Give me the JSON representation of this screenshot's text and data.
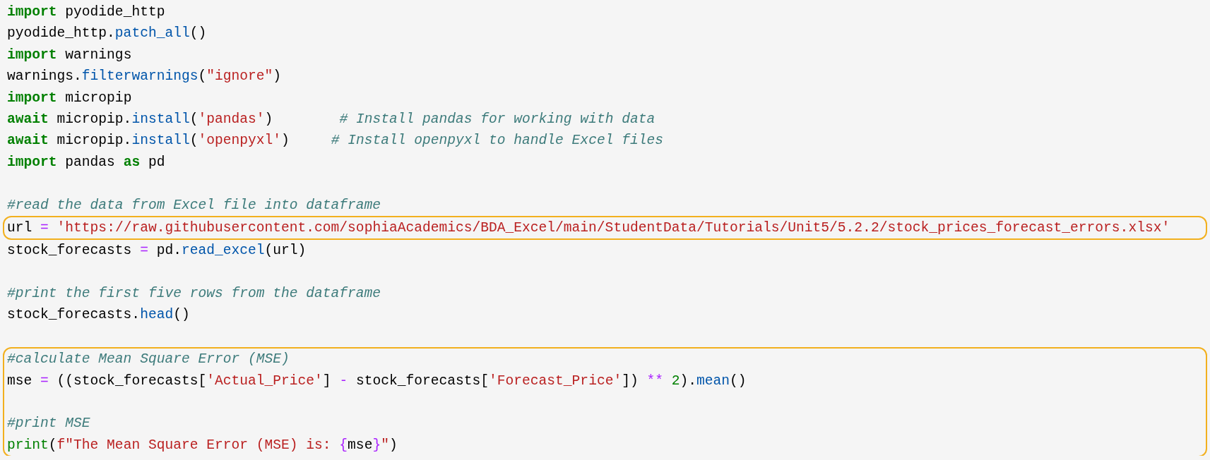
{
  "groups": [
    {
      "highlighted": false,
      "lines": [
        {
          "kind": "code",
          "tokens": [
            {
              "kind": "kw",
              "text": "import"
            },
            {
              "kind": "plain",
              "text": " pyodide_http"
            }
          ]
        },
        {
          "kind": "code",
          "tokens": [
            {
              "kind": "plain",
              "text": "pyodide_http."
            },
            {
              "kind": "fn",
              "text": "patch_all"
            },
            {
              "kind": "plain",
              "text": "()"
            }
          ]
        },
        {
          "kind": "code",
          "tokens": [
            {
              "kind": "kw",
              "text": "import"
            },
            {
              "kind": "plain",
              "text": " warnings"
            }
          ]
        },
        {
          "kind": "code",
          "tokens": [
            {
              "kind": "plain",
              "text": "warnings."
            },
            {
              "kind": "fn",
              "text": "filterwarnings"
            },
            {
              "kind": "plain",
              "text": "("
            },
            {
              "kind": "str",
              "text": "\"ignore\""
            },
            {
              "kind": "plain",
              "text": ")"
            }
          ]
        },
        {
          "kind": "code",
          "tokens": [
            {
              "kind": "kw",
              "text": "import"
            },
            {
              "kind": "plain",
              "text": " micropip"
            }
          ]
        },
        {
          "kind": "code",
          "tokens": [
            {
              "kind": "kw",
              "text": "await"
            },
            {
              "kind": "plain",
              "text": " micropip."
            },
            {
              "kind": "fn",
              "text": "install"
            },
            {
              "kind": "plain",
              "text": "("
            },
            {
              "kind": "str",
              "text": "'pandas'"
            },
            {
              "kind": "plain",
              "text": ")        "
            },
            {
              "kind": "cmt",
              "text": "# Install pandas for working with data"
            }
          ]
        },
        {
          "kind": "code",
          "tokens": [
            {
              "kind": "kw",
              "text": "await"
            },
            {
              "kind": "plain",
              "text": " micropip."
            },
            {
              "kind": "fn",
              "text": "install"
            },
            {
              "kind": "plain",
              "text": "("
            },
            {
              "kind": "str",
              "text": "'openpyxl'"
            },
            {
              "kind": "plain",
              "text": ")     "
            },
            {
              "kind": "cmt",
              "text": "# Install openpyxl to handle Excel files"
            }
          ]
        },
        {
          "kind": "code",
          "tokens": [
            {
              "kind": "kw",
              "text": "import"
            },
            {
              "kind": "plain",
              "text": " pandas "
            },
            {
              "kind": "kw",
              "text": "as"
            },
            {
              "kind": "plain",
              "text": " pd"
            }
          ]
        },
        {
          "kind": "blank"
        },
        {
          "kind": "code",
          "tokens": [
            {
              "kind": "cmt",
              "text": "#read the data from Excel file into dataframe"
            }
          ]
        }
      ]
    },
    {
      "highlighted": true,
      "lines": [
        {
          "kind": "code",
          "tokens": [
            {
              "kind": "plain",
              "text": "url "
            },
            {
              "kind": "op",
              "text": "= "
            },
            {
              "kind": "str",
              "text": "'https://raw.githubusercontent.com/sophiaAcademics/BDA_Excel/main/StudentData/Tutorials/Unit5/5.2.2/stock_prices_forecast_errors.xlsx'"
            }
          ]
        }
      ]
    },
    {
      "highlighted": false,
      "lines": [
        {
          "kind": "code",
          "tokens": [
            {
              "kind": "plain",
              "text": "stock_forecasts "
            },
            {
              "kind": "op",
              "text": "="
            },
            {
              "kind": "plain",
              "text": " pd."
            },
            {
              "kind": "fn",
              "text": "read_excel"
            },
            {
              "kind": "plain",
              "text": "(url)"
            }
          ]
        },
        {
          "kind": "blank"
        },
        {
          "kind": "code",
          "tokens": [
            {
              "kind": "cmt",
              "text": "#print the first five rows from the dataframe"
            }
          ]
        },
        {
          "kind": "code",
          "tokens": [
            {
              "kind": "plain",
              "text": "stock_forecasts."
            },
            {
              "kind": "fn",
              "text": "head"
            },
            {
              "kind": "plain",
              "text": "()"
            }
          ]
        },
        {
          "kind": "blank"
        }
      ]
    },
    {
      "highlighted": true,
      "lines": [
        {
          "kind": "code",
          "tokens": [
            {
              "kind": "cmt",
              "text": "#calculate Mean Square Error (MSE)"
            }
          ]
        },
        {
          "kind": "code",
          "tokens": [
            {
              "kind": "plain",
              "text": "mse "
            },
            {
              "kind": "op",
              "text": "="
            },
            {
              "kind": "plain",
              "text": " ((stock_forecasts["
            },
            {
              "kind": "str",
              "text": "'Actual_Price'"
            },
            {
              "kind": "plain",
              "text": "] "
            },
            {
              "kind": "op",
              "text": "-"
            },
            {
              "kind": "plain",
              "text": " stock_forecasts["
            },
            {
              "kind": "str",
              "text": "'Forecast_Price'"
            },
            {
              "kind": "plain",
              "text": "]) "
            },
            {
              "kind": "op",
              "text": "** "
            },
            {
              "kind": "num",
              "text": "2"
            },
            {
              "kind": "plain",
              "text": ")."
            },
            {
              "kind": "fn",
              "text": "mean"
            },
            {
              "kind": "plain",
              "text": "()"
            }
          ]
        },
        {
          "kind": "blank"
        },
        {
          "kind": "code",
          "tokens": [
            {
              "kind": "cmt",
              "text": "#print MSE"
            }
          ]
        },
        {
          "kind": "code",
          "tokens": [
            {
              "kind": "builtin",
              "text": "print"
            },
            {
              "kind": "plain",
              "text": "("
            },
            {
              "kind": "fstr",
              "text": "f\"The Mean Square Error (MSE) is: "
            },
            {
              "kind": "op",
              "text": "{"
            },
            {
              "kind": "plain",
              "text": "mse"
            },
            {
              "kind": "op",
              "text": "}"
            },
            {
              "kind": "fstr",
              "text": "\""
            },
            {
              "kind": "plain",
              "text": ")"
            }
          ]
        }
      ]
    }
  ]
}
